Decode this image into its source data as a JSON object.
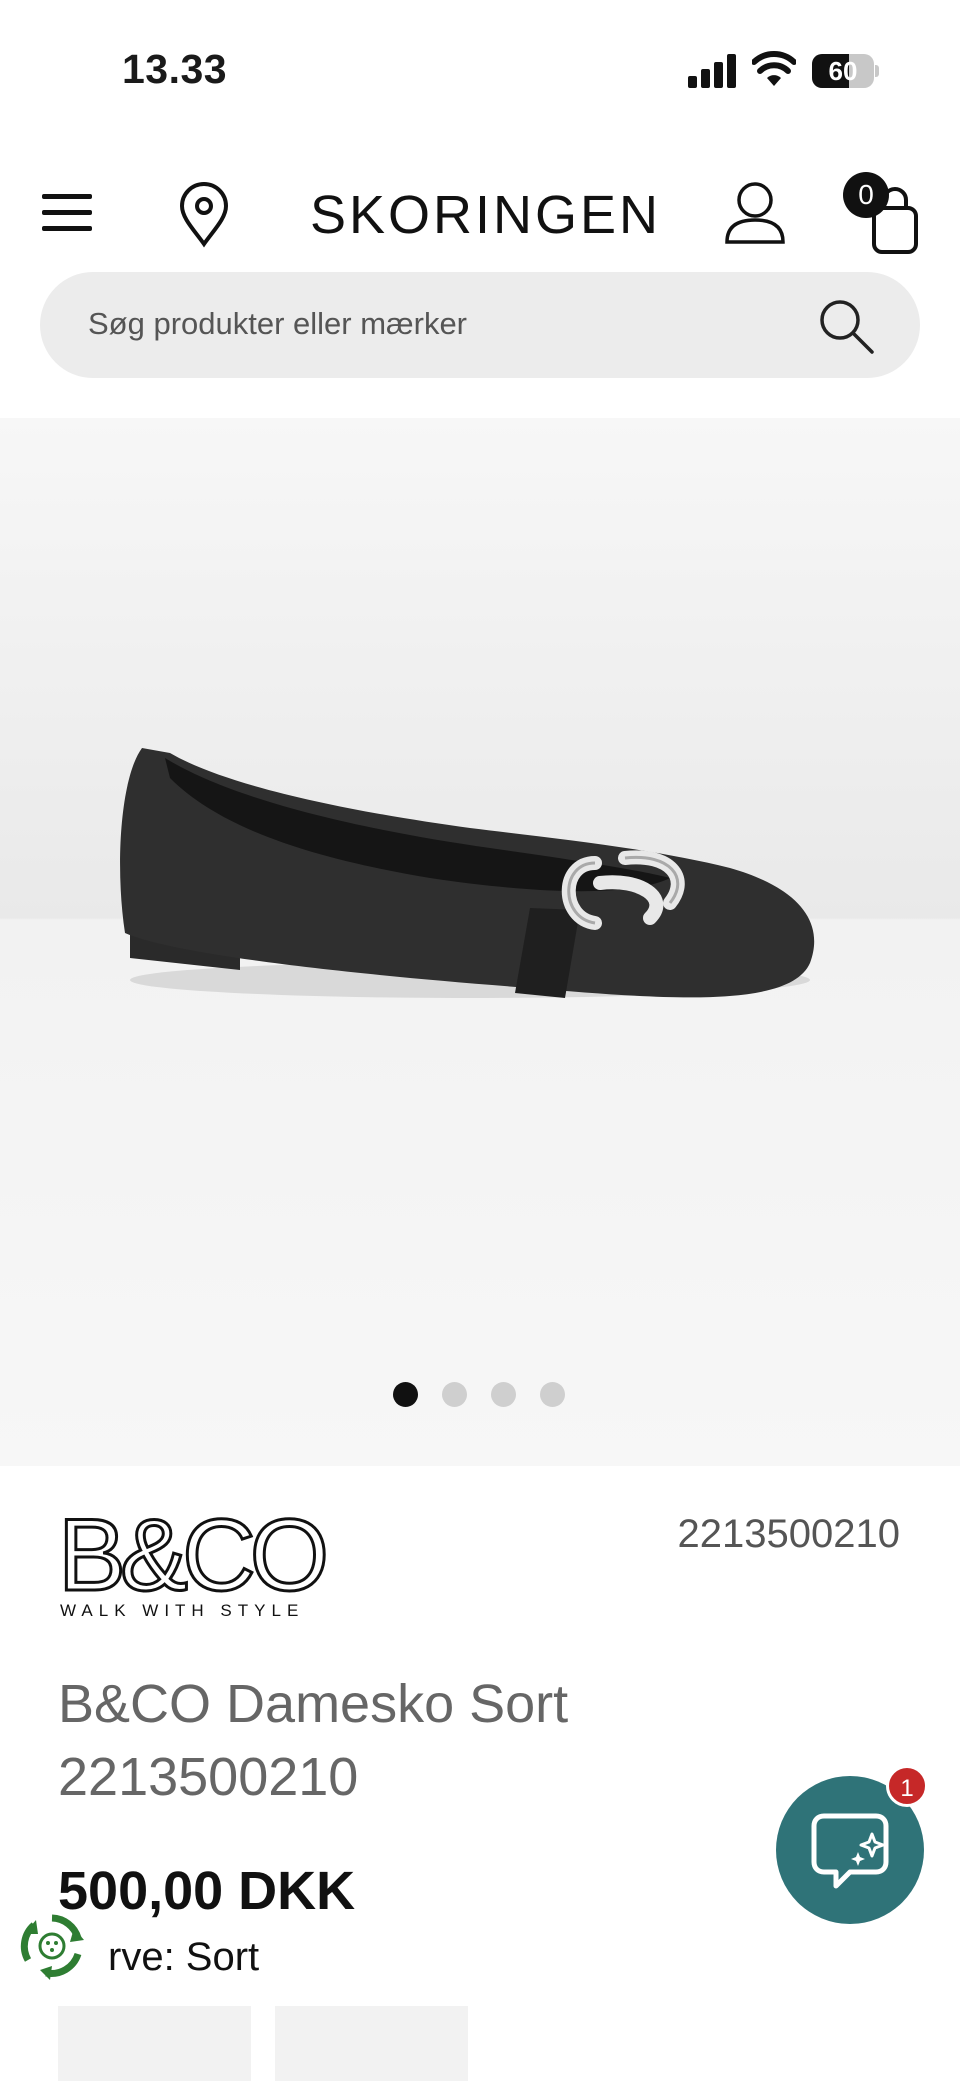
{
  "status_bar": {
    "time": "13.33",
    "battery_level": "60"
  },
  "header": {
    "logo": "SKORINGEN",
    "cart_count": "0"
  },
  "search": {
    "placeholder": "Søg produkter eller mærker"
  },
  "gallery": {
    "image_count": 4,
    "active_index": 0
  },
  "product": {
    "brand_logo_text": "B&CO",
    "brand_tagline": "WALK WITH STYLE",
    "sku": "2213500210",
    "title": "B&CO Damesko Sort 2213500210",
    "price": "500,00 DKK",
    "color": "rve: Sort"
  },
  "chat": {
    "badge_count": "1"
  },
  "colors": {
    "chat_teal": "#2f7378",
    "badge_red": "#c62828",
    "search_bg": "#ececec",
    "eco_green": "#2e7d32"
  }
}
